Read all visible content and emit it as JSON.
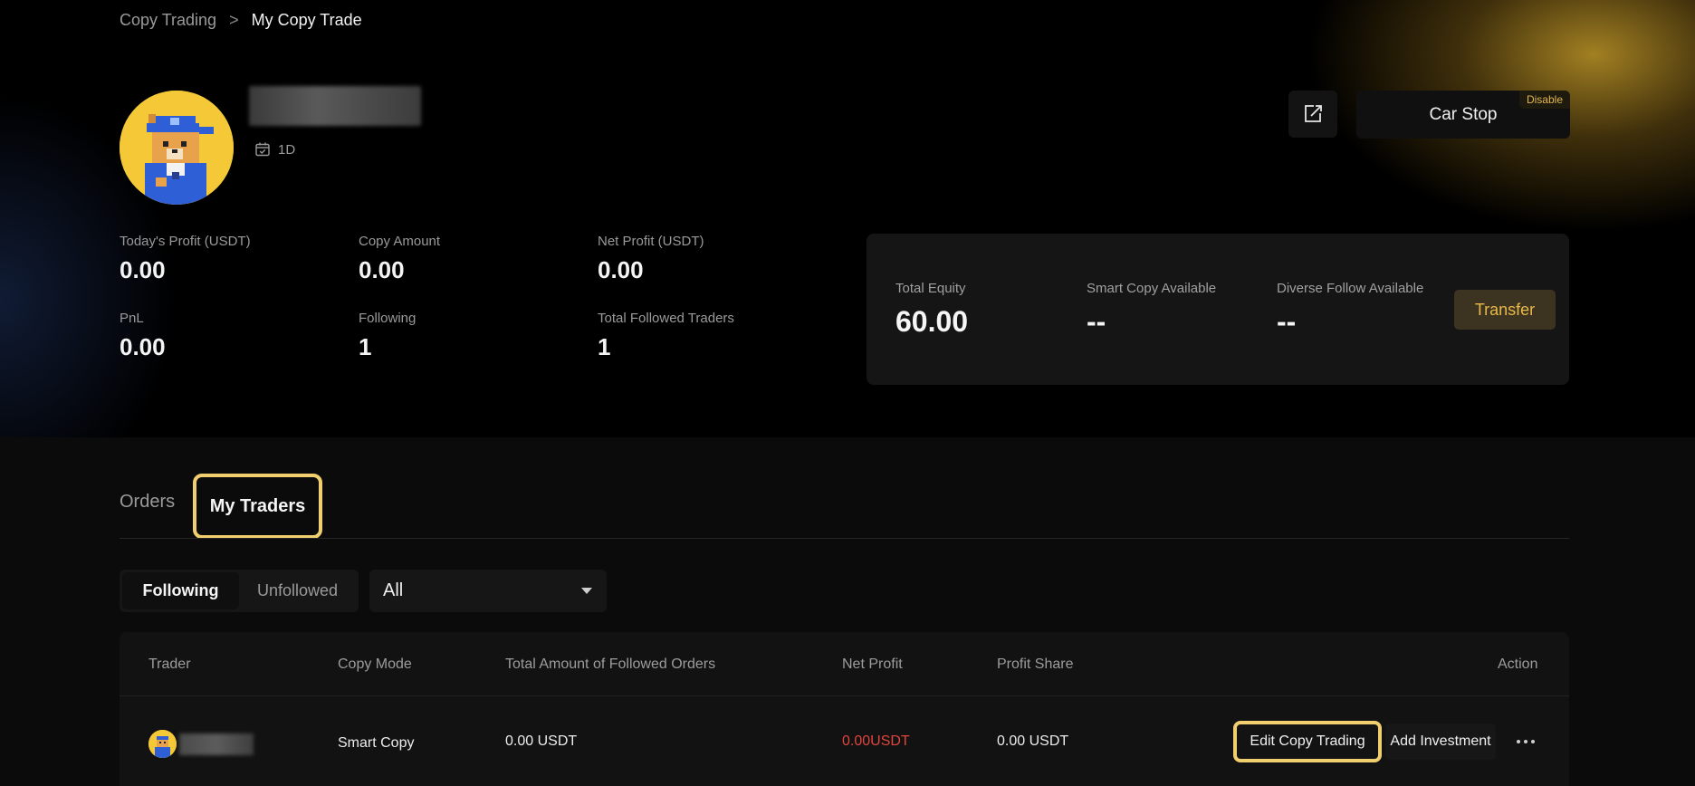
{
  "breadcrumb": {
    "parent": "Copy Trading",
    "current": "My Copy Trade",
    "separator": ">"
  },
  "profile": {
    "period": "1D",
    "calendar_icon": "calendar-check-icon",
    "avatar_icon": "pixel-bear-avatar"
  },
  "actions": {
    "share_icon": "share-edit-icon",
    "stop_label": "Car Stop",
    "stop_badge": "Disable"
  },
  "stats": [
    {
      "label": "Today's Profit (USDT)",
      "value": "0.00"
    },
    {
      "label": "Copy Amount",
      "value": "0.00"
    },
    {
      "label": "Net Profit (USDT)",
      "value": "0.00"
    },
    {
      "label": "PnL",
      "value": "0.00"
    },
    {
      "label": "Following",
      "value": "1"
    },
    {
      "label": "Total Followed Traders",
      "value": "1"
    }
  ],
  "equity": {
    "total_label": "Total Equity",
    "total_value": "60.00",
    "smart_label": "Smart Copy Available",
    "smart_value": "--",
    "diverse_label": "Diverse Follow Available",
    "diverse_value": "--",
    "transfer_label": "Transfer"
  },
  "tabs": {
    "orders": "Orders",
    "traders": "My Traders"
  },
  "filters": {
    "following": "Following",
    "unfollowed": "Unfollowed",
    "select_value": "All"
  },
  "table": {
    "headers": [
      "Trader",
      "Copy Mode",
      "Total Amount of Followed Orders",
      "Net Profit",
      "Profit Share",
      "Action"
    ],
    "rows": [
      {
        "copy_mode": "Smart Copy",
        "total_amount": "0.00 USDT",
        "net_profit": "0.00USDT",
        "profit_share": "0.00 USDT",
        "edit_label": "Edit Copy Trading",
        "add_label": "Add Investment",
        "more_icon": "more-horizontal-icon"
      }
    ]
  },
  "colors": {
    "accent": "#f1cf6e",
    "loss": "#e0453d",
    "transfer_text": "#e9b84a"
  }
}
